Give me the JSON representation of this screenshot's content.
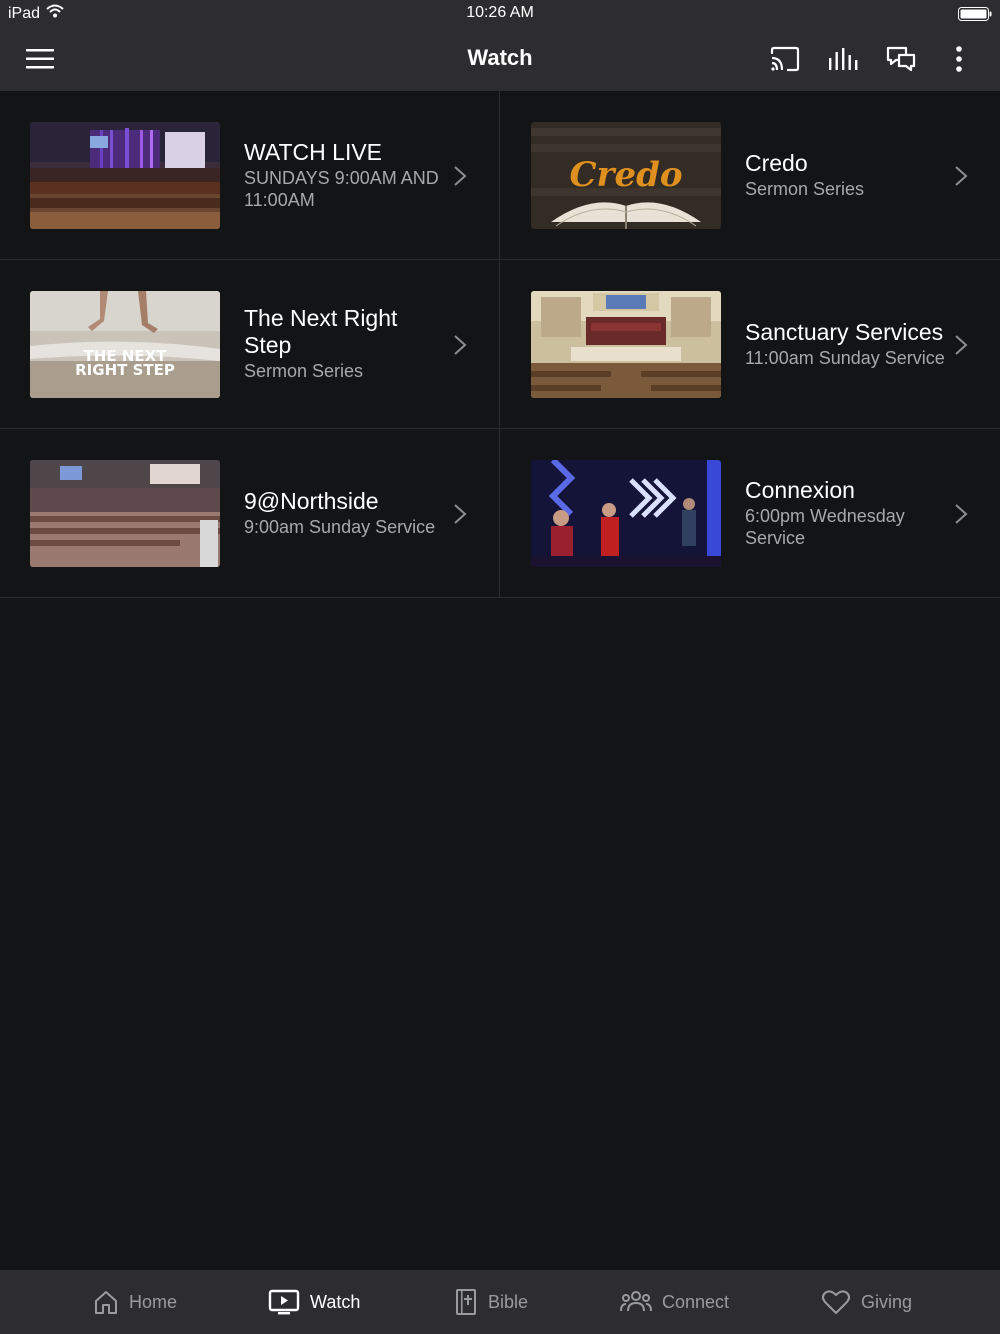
{
  "status_bar": {
    "device": "iPad",
    "time": "10:26 AM"
  },
  "header": {
    "title": "Watch",
    "icons": [
      "menu-icon",
      "cast-icon",
      "audio-bars-icon",
      "chat-icon",
      "more-vertical-icon"
    ]
  },
  "items": [
    {
      "title": "WATCH LIVE",
      "subtitle": "SUNDAYS 9:00AM AND 11:00AM",
      "thumb": "sanctuary-stage-purple-lights"
    },
    {
      "title": "Credo",
      "subtitle": "Sermon Series",
      "thumb": "credo-bible-artwork"
    },
    {
      "title": "The Next Right Step",
      "subtitle": "Sermon Series",
      "thumb": "beach-footsteps-artwork",
      "thumb_text": "THE NEXT RIGHT STEP"
    },
    {
      "title": "Sanctuary Services",
      "subtitle": "11:00am Sunday Service",
      "thumb": "sanctuary-choir-stage"
    },
    {
      "title": "9@Northside",
      "subtitle": "9:00am Sunday Service",
      "thumb": "worship-hall-congregation"
    },
    {
      "title": "Connexion",
      "subtitle": "6:00pm Wednesday Service",
      "thumb": "band-stage-blue-lights"
    }
  ],
  "tabs": [
    {
      "label": "Home",
      "icon": "home-icon",
      "active": false
    },
    {
      "label": "Watch",
      "icon": "video-icon",
      "active": true
    },
    {
      "label": "Bible",
      "icon": "bible-icon",
      "active": false
    },
    {
      "label": "Connect",
      "icon": "people-icon",
      "active": false
    },
    {
      "label": "Giving",
      "icon": "heart-icon",
      "active": false
    }
  ],
  "colors": {
    "background": "#131416",
    "bars": "#2d2d2f",
    "primary_text": "#ffffff",
    "secondary_text": "#a7a8ab",
    "inactive_tab": "#9a9b9e",
    "credo_gold": "#e0901e"
  }
}
